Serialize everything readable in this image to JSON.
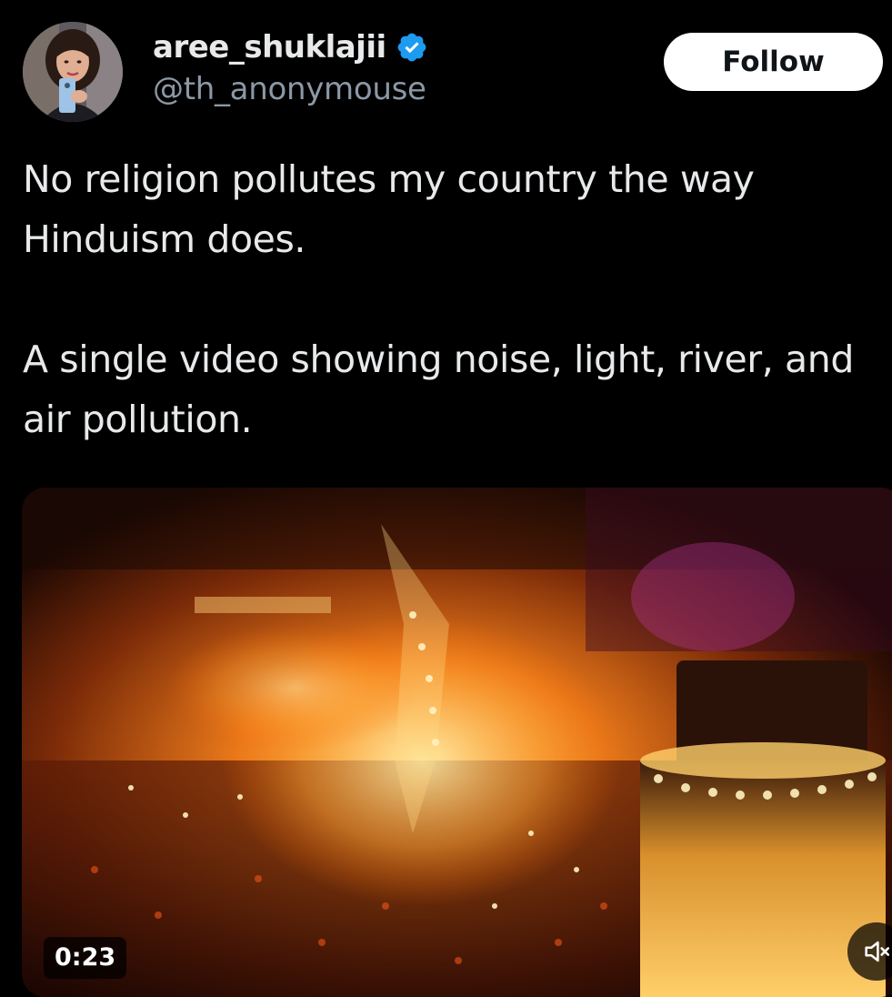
{
  "author": {
    "display_name": "aree_shuklajii",
    "handle": "@th_anonymouse",
    "verified": true,
    "avatar_icon": "profile-photo"
  },
  "follow_button": {
    "label": "Follow"
  },
  "tweet": {
    "paragraphs": [
      "No religion pollutes my country the way Hinduism does.",
      "A single video showing noise, light, river, and air pollution."
    ]
  },
  "media": {
    "type": "video",
    "duration": "0:23",
    "mute_icon": "speaker-muted-icon"
  },
  "colors": {
    "background": "#000000",
    "text_primary": "#e7e9ea",
    "text_secondary": "#8b98a5",
    "verified_blue": "#1d9bf0",
    "follow_bg": "#ffffff",
    "follow_text": "#0f1419"
  }
}
